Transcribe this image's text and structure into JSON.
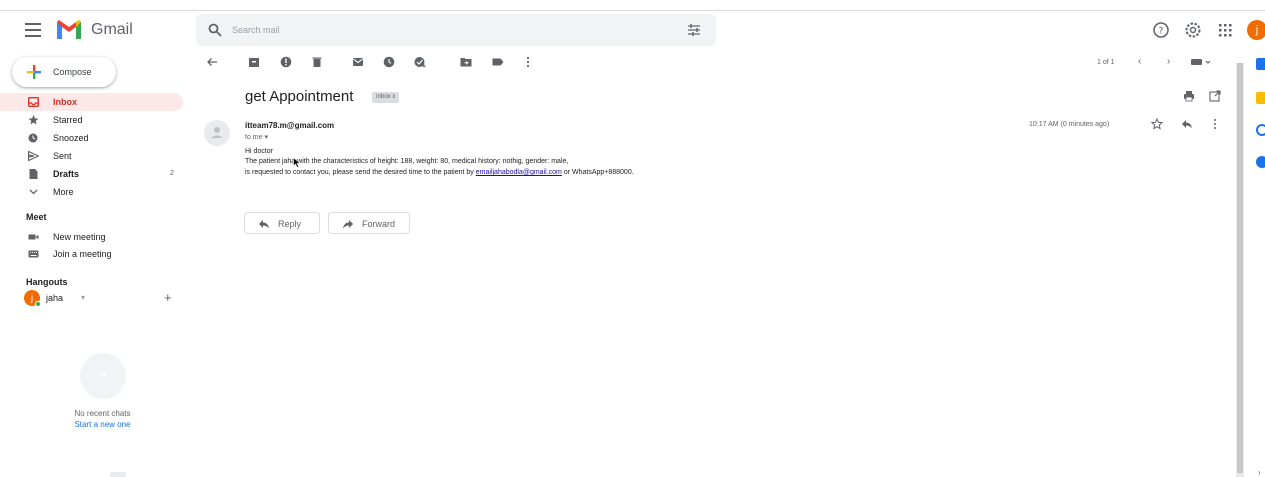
{
  "header": {
    "app_name": "Gmail",
    "search_placeholder": "Search mail",
    "avatar_letter": "j"
  },
  "sidebar": {
    "compose_label": "Compose",
    "items": [
      {
        "label": "Inbox",
        "icon": "inbox-icon",
        "active": true
      },
      {
        "label": "Starred",
        "icon": "star-icon"
      },
      {
        "label": "Snoozed",
        "icon": "clock-icon"
      },
      {
        "label": "Sent",
        "icon": "send-icon"
      },
      {
        "label": "Drafts",
        "icon": "draft-icon",
        "count": "2"
      },
      {
        "label": "More",
        "icon": "chevron-down-icon"
      }
    ],
    "meet": {
      "title": "Meet",
      "items": [
        {
          "label": "New meeting",
          "icon": "video-icon"
        },
        {
          "label": "Join a meeting",
          "icon": "keyboard-icon"
        }
      ]
    },
    "hangouts": {
      "title": "Hangouts",
      "user_letter": "j",
      "user_name": "jaha",
      "no_chats": "No recent chats",
      "start_new": "Start a new one"
    }
  },
  "toolbar": {
    "pager": "1 of 1"
  },
  "message": {
    "subject": "get Appointment",
    "label_chip": "Inbox x",
    "sender": "itteam78.m@gmail.com",
    "to": "to me",
    "time": "10:17 AM (0 minutes ago)",
    "greeting": "Hi doctor",
    "line1": "The patient jaha with the characteristics of height: 188, weight: 80, medical history: nothig, gender: male,",
    "line2_prefix": "is requested to contact you, please send the desired time to the patient by",
    "line2_link": "emailjahabodla@gmail.com",
    "line2_suffix": "or WhatsApp+888000."
  },
  "actions": {
    "reply": "Reply",
    "forward": "Forward"
  },
  "colors": {
    "accent_red": "#d93025",
    "active_bg": "#fce8e6",
    "link": "#1a0dab",
    "avatar": "#ef6c00"
  }
}
